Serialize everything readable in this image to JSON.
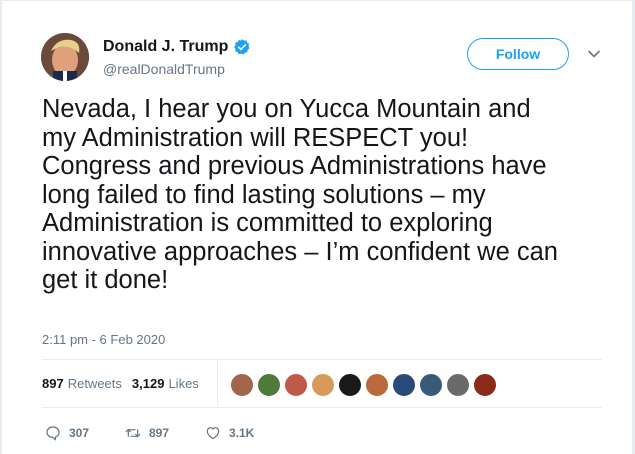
{
  "author": {
    "name": "Donald J. Trump",
    "handle": "@realDonaldTrump",
    "verified": true
  },
  "follow_button": {
    "label": "Follow"
  },
  "tweet": {
    "text": "Nevada, I hear you on Yucca Mountain and\nmy Administration will RESPECT you!\nCongress and previous Administrations have\nlong failed to find lasting solutions – my\nAdministration is committed to exploring\ninnovative approaches – I’m confident we can\nget it done!",
    "timestamp": "2:11 pm - 6 Feb 2020"
  },
  "stats": {
    "retweets_count": "897",
    "retweets_label": "Retweets",
    "likes_count": "3,129",
    "likes_label": "Likes"
  },
  "actions": {
    "replies": "307",
    "retweets": "897",
    "likes": "3.1K"
  },
  "colors": {
    "accent": "#1da1f2",
    "secondary_text": "#657786",
    "border": "#e6ecf0"
  },
  "liker_avatars": [
    "#a0654a",
    "#4f7a3a",
    "#c05a4a",
    "#d89a5a",
    "#1a1a1a",
    "#b86a3a",
    "#2a4a7a",
    "#3a5a7a",
    "#6a6a6a",
    "#8a2a1a"
  ]
}
